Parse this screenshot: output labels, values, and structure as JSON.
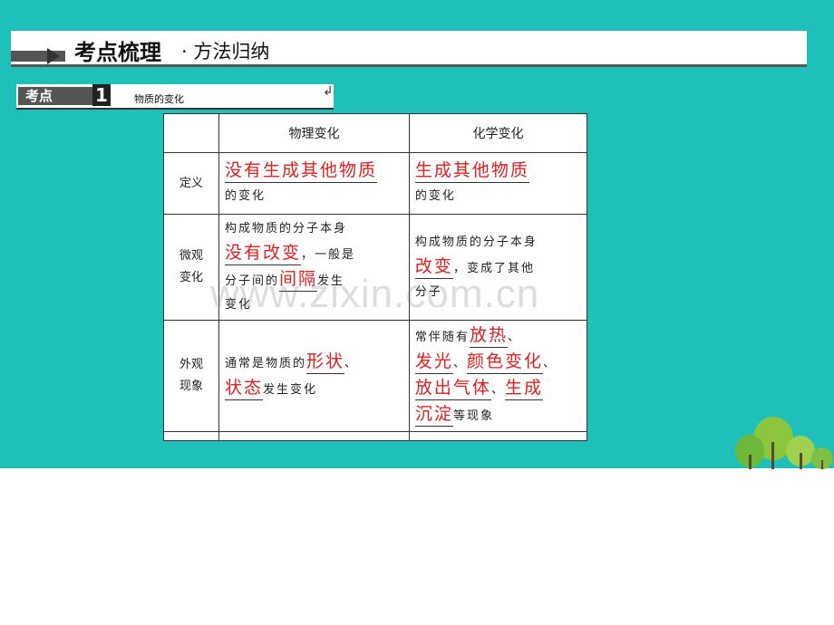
{
  "header": {
    "title": "考点梳理",
    "subtitle": "· 方法归纳"
  },
  "section": {
    "tag": "考点",
    "number": "1",
    "topic": "物质的变化",
    "return_icon": "return-arrow-icon"
  },
  "table": {
    "columns": [
      "物理变化",
      "化学变化"
    ],
    "rows": {
      "definition": {
        "label": "定义",
        "physical_answer": "没有生成其他物质",
        "physical_tail": "的变化",
        "chemical_answer": "生成其他物质",
        "chemical_tail": "的变化"
      },
      "micro": {
        "label_1": "微观",
        "label_2": "变化",
        "physical_p1": "构成物质的分子本身",
        "physical_a1": "没有改变",
        "physical_p2": "，一般是",
        "physical_p3": "分子间的",
        "physical_a2": "间隔",
        "physical_p4": "发生",
        "physical_p5": "变化",
        "chemical_p1": "构成物质的分子本身",
        "chemical_a1": "改变",
        "chemical_p2": "，变成了其他",
        "chemical_p3": "分子"
      },
      "appearance": {
        "label_1": "外观",
        "label_2": "现象",
        "physical_p1": "通常是物质的",
        "physical_a1": "形状",
        "physical_sep": "、",
        "physical_a2": "状态",
        "physical_p2": "发生变化",
        "chemical_p1": "常伴随有",
        "chemical_a1": "放热",
        "chemical_sep1": "、",
        "chemical_a2": "发光",
        "chemical_sep2": "、",
        "chemical_a3": "颜色变化",
        "chemical_sep3": "、",
        "chemical_a4": "放出气体",
        "chemical_sep4": "、",
        "chemical_a5": "生成",
        "chemical_a6": "沉淀",
        "chemical_p2": "等现象"
      }
    }
  },
  "watermark": "www.zixin.com.cn",
  "colors": {
    "background": "#1ec0b9",
    "answer": "#e02020"
  }
}
